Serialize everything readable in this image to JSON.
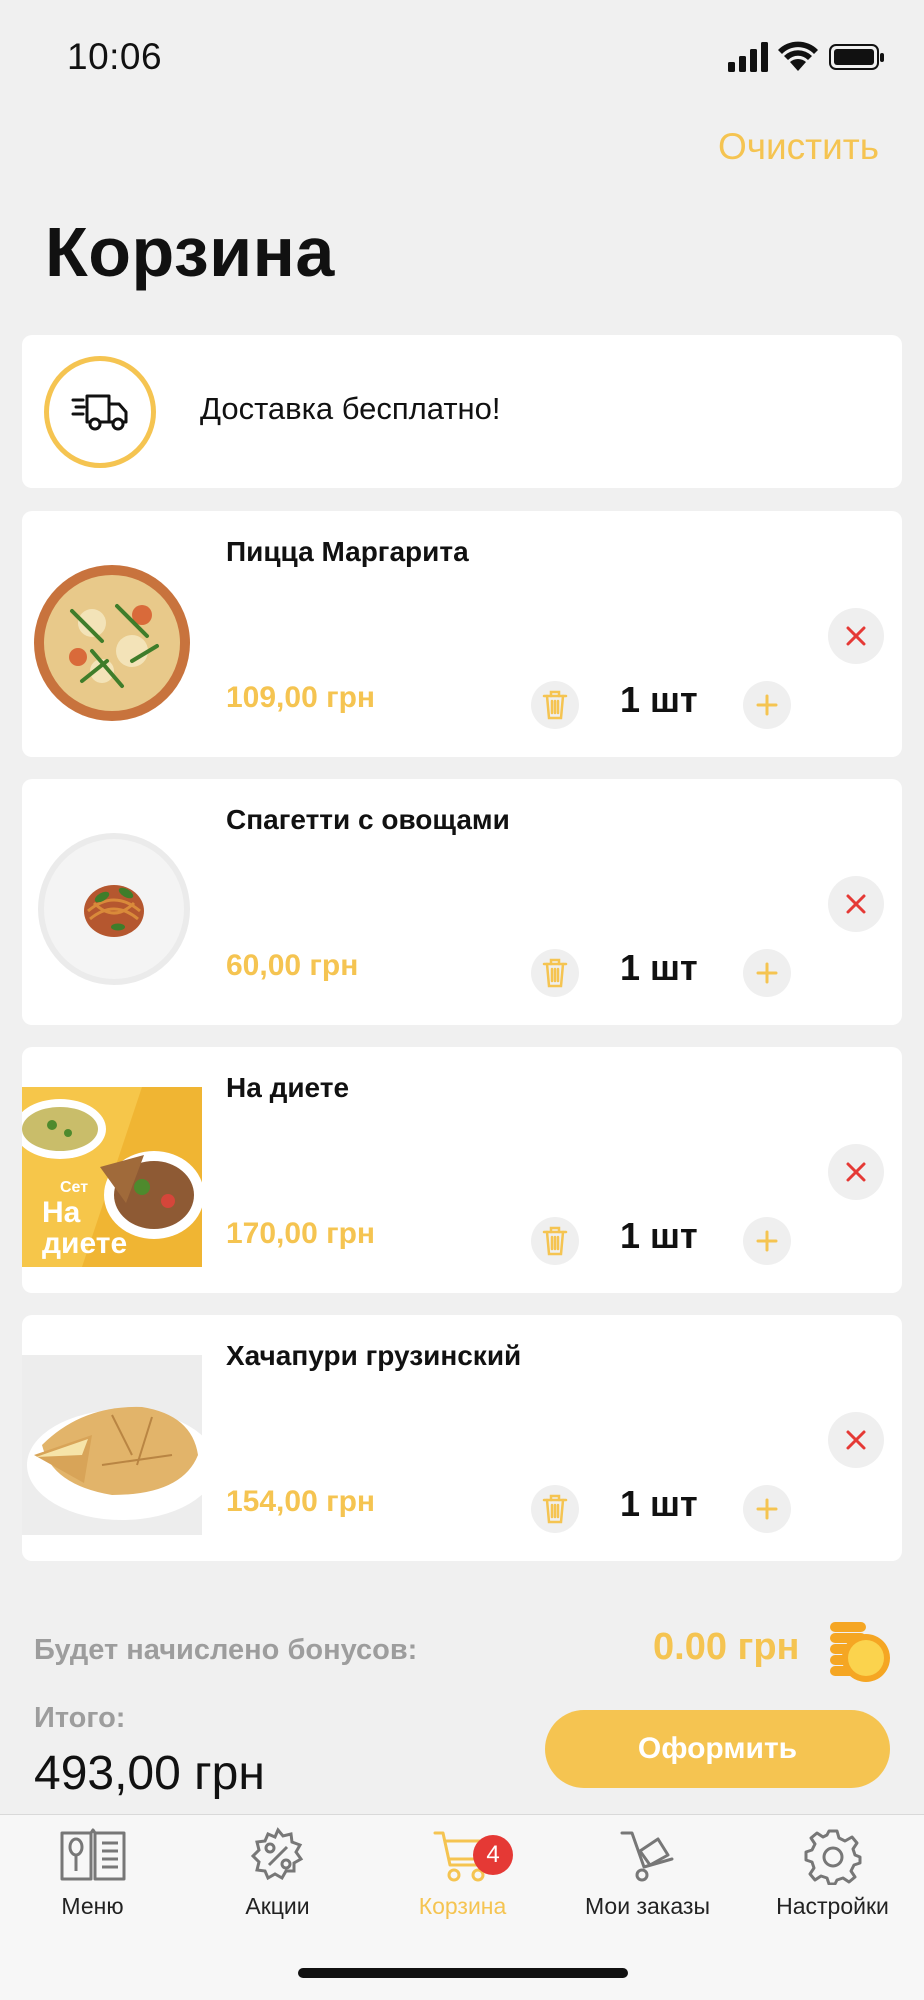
{
  "status_bar": {
    "time": "10:06"
  },
  "header": {
    "clear_label": "Очистить",
    "title": "Корзина"
  },
  "delivery": {
    "text": "Доставка бесплатно!"
  },
  "items": [
    {
      "name": "Пицца Маргарита",
      "price": "109,00 грн",
      "qty": "1 шт",
      "image": "pizza-image"
    },
    {
      "name": "Спагетти с овощами",
      "price": "60,00 грн",
      "qty": "1 шт",
      "image": "spaghetti-image"
    },
    {
      "name": "На диете",
      "price": "170,00 грн",
      "qty": "1 шт",
      "image": "diet-set-image",
      "image_text": [
        "Сет",
        "На",
        "диете"
      ]
    },
    {
      "name": "Хачапури грузинский",
      "price": "154,00 грн",
      "qty": "1 шт",
      "image": "khachapuri-image"
    }
  ],
  "summary": {
    "bonus_label": "Будет начислено бонусов:",
    "bonus_value": "0.00 грн",
    "total_label": "Итого:",
    "total_value": "493,00 грн",
    "checkout_label": "Оформить"
  },
  "tabbar": {
    "tabs": [
      {
        "label": "Меню",
        "icon": "menu-book-icon"
      },
      {
        "label": "Акции",
        "icon": "percent-gear-icon"
      },
      {
        "label": "Корзина",
        "icon": "cart-icon",
        "badge": "4",
        "active": true
      },
      {
        "label": "Мои заказы",
        "icon": "hand-truck-icon"
      },
      {
        "label": "Настройки",
        "icon": "gear-icon"
      }
    ]
  },
  "colors": {
    "accent": "#f5c451",
    "danger": "#e53935",
    "background": "#f0f0f0"
  }
}
